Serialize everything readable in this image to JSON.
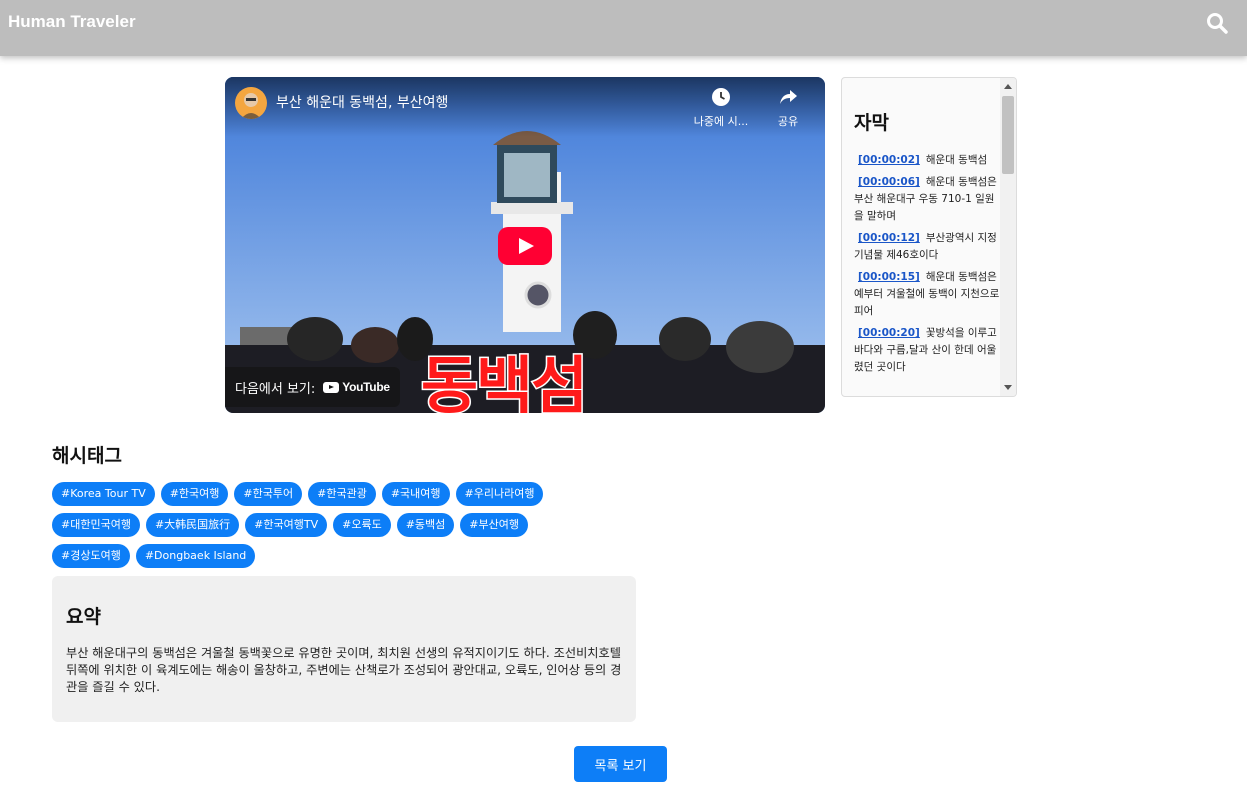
{
  "header": {
    "brand": "Human Traveler",
    "search_icon": "search-icon"
  },
  "video": {
    "title": "부산 해운대 동백섬, 부산여행",
    "watch_later_label": "나중에 시...",
    "share_label": "공유",
    "watch_on_label": "다음에서 보기:",
    "youtube_label": "YouTube",
    "overlay_text": "동백섬",
    "icons": [
      "clock-icon",
      "share-icon",
      "play-icon"
    ]
  },
  "subtitles": {
    "title": "자막",
    "items": [
      {
        "time": "[00:00:02]",
        "text": "해운대 동백섬"
      },
      {
        "time": "[00:00:06]",
        "text": "해운대 동백섬은 부산 해운대구 우동 710-1 일원을 말하며"
      },
      {
        "time": "[00:00:12]",
        "text": "부산광역시 지정 기념물 제46호이다"
      },
      {
        "time": "[00:00:15]",
        "text": "해운대 동백섬은 예부터 겨울철에 동백이 지천으로 피어"
      },
      {
        "time": "[00:00:20]",
        "text": "꽃방석을 이루고 바다와 구름,달과 산이 한데 어울렸던 곳이다"
      }
    ]
  },
  "hashtags": {
    "title": "해시태그",
    "tags": [
      "#Korea Tour TV",
      "#한국여행",
      "#한국투어",
      "#한국관광",
      "#국내여행",
      "#우리나라여행",
      "#대한민국여행",
      "#大韩民国旅行",
      "#한국여행TV",
      "#오륙도",
      "#동백섬",
      "#부산여행",
      "#경상도여행",
      "#Dongbaek Island"
    ]
  },
  "summary": {
    "title": "요약",
    "text": "부산 해운대구의 동백섬은 겨울철 동백꽃으로 유명한 곳이며, 최치원 선생의 유적지이기도 하다. 조선비치호텔 뒤쪽에 위치한 이 육계도에는 해송이 울창하고, 주변에는 산책로가 조성되어 광안대교, 오륙도, 인어상 등의 경관을 즐길 수 있다."
  },
  "actions": {
    "list_button": "목록 보기"
  },
  "colors": {
    "header": "#bdbdbd",
    "accent": "#0d7ef7",
    "youtube_red": "#ff0033",
    "timestamp": "#1a56c8",
    "summary_bg": "#f0f0f0"
  }
}
